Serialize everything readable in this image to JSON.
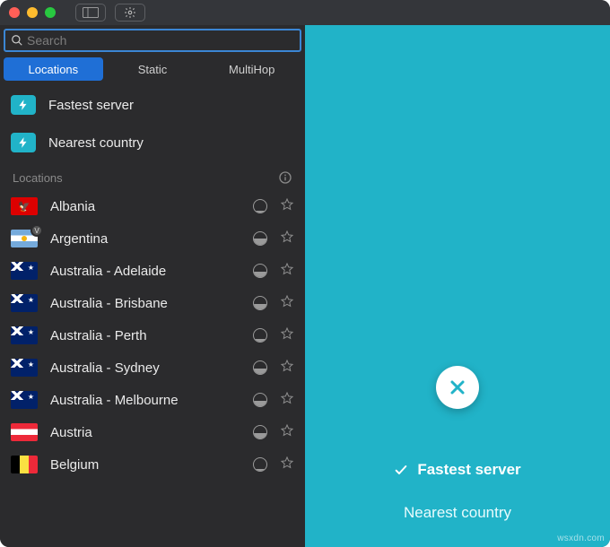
{
  "colors": {
    "accent": "#21b3c8",
    "tab_active": "#1f6fd6",
    "bg_dark": "#2b2b2d"
  },
  "search": {
    "placeholder": "Search",
    "value": ""
  },
  "tabs": [
    {
      "label": "Locations",
      "active": true
    },
    {
      "label": "Static",
      "active": false
    },
    {
      "label": "MultiHop",
      "active": false
    }
  ],
  "quick": [
    {
      "icon": "bolt-icon",
      "label": "Fastest server"
    },
    {
      "icon": "bolt-icon",
      "label": "Nearest country"
    }
  ],
  "section": {
    "title": "Locations",
    "info_icon": "info-icon"
  },
  "locations": [
    {
      "name": "Albania",
      "flag": "al",
      "load": 0.15,
      "badge": null
    },
    {
      "name": "Argentina",
      "flag": "ar",
      "load": 0.5,
      "badge": "V"
    },
    {
      "name": "Australia - Adelaide",
      "flag": "au",
      "load": 0.45,
      "badge": null
    },
    {
      "name": "Australia - Brisbane",
      "flag": "au",
      "load": 0.45,
      "badge": null
    },
    {
      "name": "Australia - Perth",
      "flag": "au",
      "load": 0.2,
      "badge": null
    },
    {
      "name": "Australia - Sydney",
      "flag": "au",
      "load": 0.45,
      "badge": null
    },
    {
      "name": "Australia - Melbourne",
      "flag": "au",
      "load": 0.45,
      "badge": null
    },
    {
      "name": "Austria",
      "flag": "at",
      "load": 0.45,
      "badge": null
    },
    {
      "name": "Belgium",
      "flag": "be",
      "load": 0.15,
      "badge": null
    }
  ],
  "panel": {
    "disconnect_icon": "close-icon",
    "primary": {
      "icon": "check-icon",
      "label": "Fastest server"
    },
    "secondary": {
      "label": "Nearest country"
    }
  },
  "watermark": "wsxdn.com"
}
